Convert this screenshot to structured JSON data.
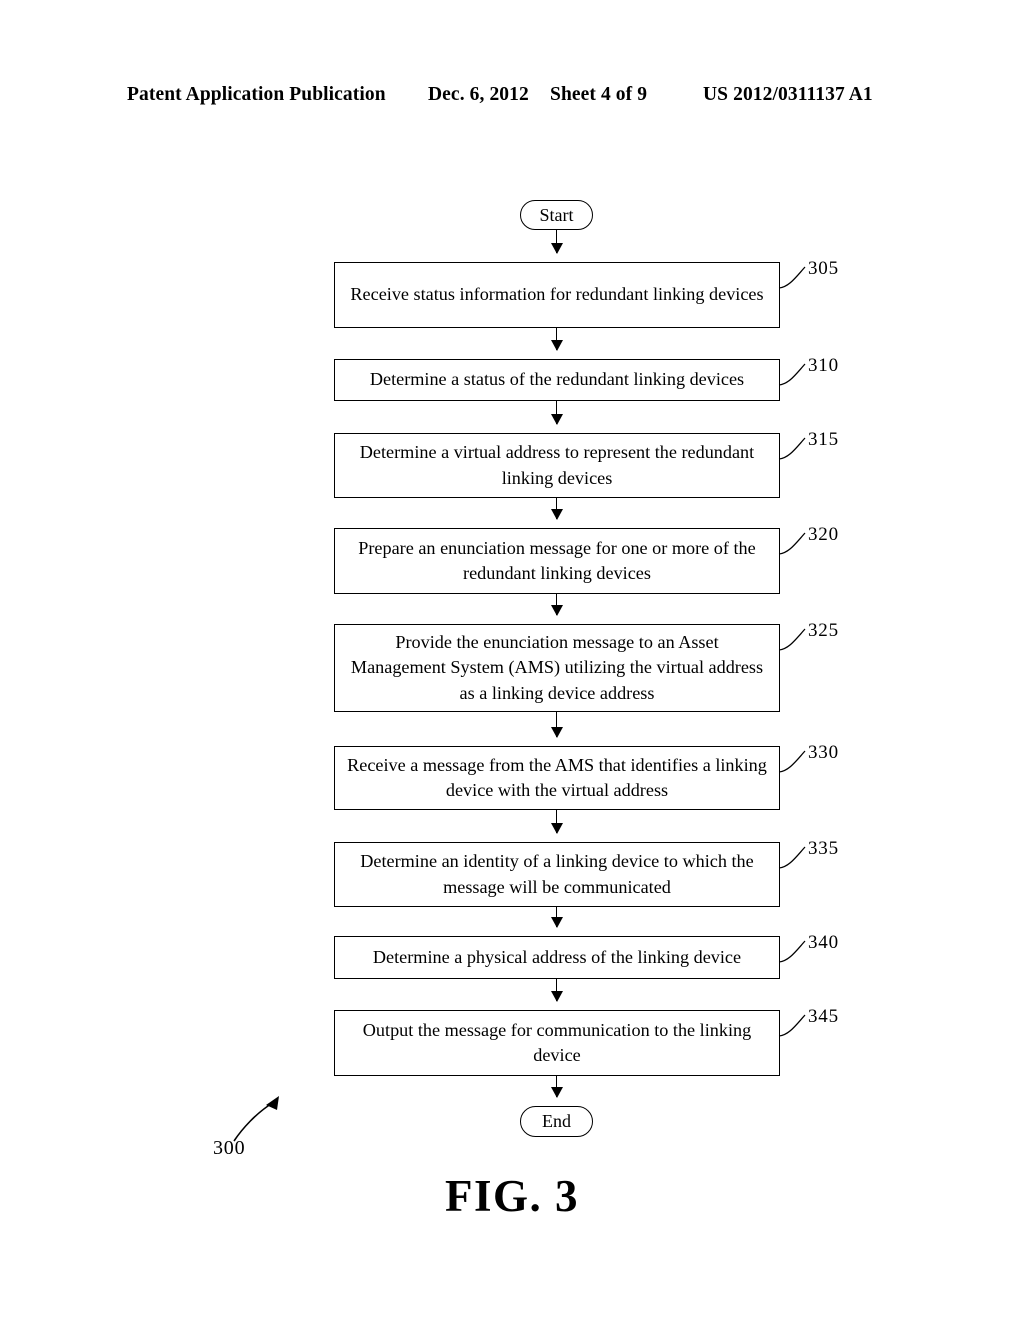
{
  "header": {
    "publication": "Patent Application Publication",
    "date": "Dec. 6, 2012",
    "sheet": "Sheet 4 of 9",
    "patent_number": "US 2012/0311137 A1"
  },
  "figure": {
    "caption": "FIG. 3",
    "reference_numeral": "300"
  },
  "flowchart": {
    "start_label": "Start",
    "end_label": "End",
    "steps": [
      {
        "ref": "305",
        "text": "Receive status information for redundant linking devices"
      },
      {
        "ref": "310",
        "text": "Determine a status of the redundant linking devices"
      },
      {
        "ref": "315",
        "text": "Determine a virtual address to represent the redundant linking devices"
      },
      {
        "ref": "320",
        "text": "Prepare an enunciation message for one or more of the redundant linking devices"
      },
      {
        "ref": "325",
        "text": "Provide the enunciation message to an Asset Management System (AMS) utilizing the virtual address as a linking device address"
      },
      {
        "ref": "330",
        "text": "Receive a message from the AMS that identifies a linking device with the virtual address"
      },
      {
        "ref": "335",
        "text": "Determine an identity of a linking device to which the message will be communicated"
      },
      {
        "ref": "340",
        "text": "Determine a physical address of the linking device"
      },
      {
        "ref": "345",
        "text": "Output the message for communication to the linking device"
      }
    ]
  }
}
